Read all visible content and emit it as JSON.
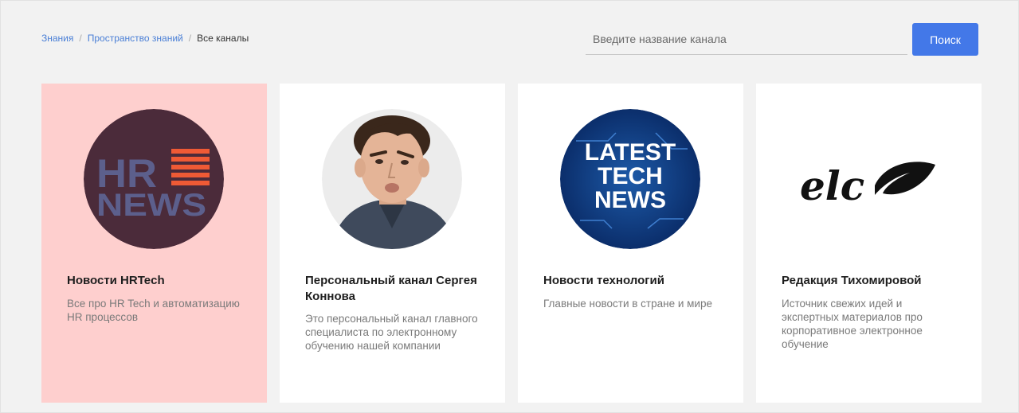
{
  "breadcrumb": {
    "items": [
      "Знания",
      "Пространство знаний"
    ],
    "current": "Все каналы",
    "separator": "/"
  },
  "search": {
    "placeholder": "Введите название канала",
    "value": "",
    "button_label": "Поиск"
  },
  "channels": [
    {
      "title": "Новости HRTech",
      "description": "Все про HR Tech и автоматизацию HR процессов",
      "logo": {
        "line1": "HR",
        "line2": "NEWS"
      },
      "selected": true
    },
    {
      "title": "Персональный канал Сергея Коннова",
      "description": "Это персональный канал главного специалиста по электронному обучению нашей компании",
      "selected": false
    },
    {
      "title": "Новости технологий",
      "description": "Главные новости в стране и мире",
      "logo": {
        "line1": "LATEST",
        "line2": "TECH",
        "line3": "NEWS"
      },
      "selected": false
    },
    {
      "title": "Редакция Тихомировой",
      "description": "Источник свежих идей и экспертных материалов про корпоративное электронное обучение",
      "logo": {
        "text": "elc"
      },
      "selected": false
    }
  ],
  "colors": {
    "accent": "#4378e8",
    "link": "#4a7fd6",
    "selected_card": "#fecfce",
    "background": "#f2f2f2"
  }
}
